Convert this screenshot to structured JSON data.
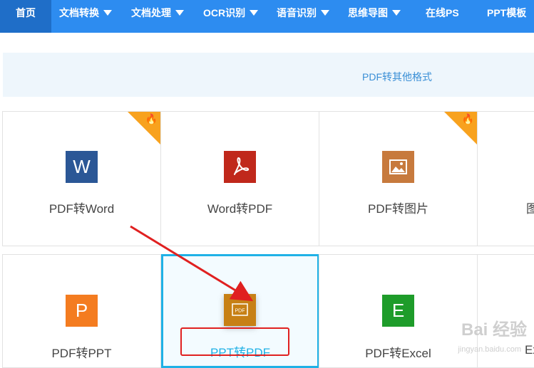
{
  "nav": {
    "items": [
      {
        "label": "首页",
        "active": true,
        "dropdown": false
      },
      {
        "label": "文档转换",
        "dropdown": true
      },
      {
        "label": "文档处理",
        "dropdown": true
      },
      {
        "label": "OCR识别",
        "dropdown": true
      },
      {
        "label": "语音识别",
        "dropdown": true
      },
      {
        "label": "思维导图",
        "dropdown": true
      },
      {
        "label": "在线PS",
        "dropdown": false
      },
      {
        "label": "PPT模板",
        "dropdown": false
      }
    ]
  },
  "category": {
    "label": "PDF转其他格式"
  },
  "tools": {
    "row1": [
      {
        "label": "PDF转Word",
        "icon": "word-icon",
        "icon_text": "W",
        "color": "#2b5796",
        "hot": true
      },
      {
        "label": "Word转PDF",
        "icon": "pdf-icon",
        "icon_text": "",
        "color": "#c0281b",
        "hot": false
      },
      {
        "label": "PDF转图片",
        "icon": "image-icon",
        "icon_text": "",
        "color": "#c77a3d",
        "hot": true
      },
      {
        "label": "图",
        "icon": "",
        "hot": false
      }
    ],
    "row2": [
      {
        "label": "PDF转PPT",
        "icon": "powerpoint-icon",
        "icon_text": "P",
        "color": "#f47c20"
      },
      {
        "label": "PPT转PDF",
        "icon": "ppt-to-pdf-icon",
        "icon_text": "PDF",
        "color": "#c78015",
        "selected": true
      },
      {
        "label": "PDF转Excel",
        "icon": "excel-icon",
        "icon_text": "E",
        "color": "#1e9c2a"
      },
      {
        "label": "Ex",
        "icon": ""
      }
    ]
  },
  "colors": {
    "nav_bg": "#2d8cf0",
    "nav_active": "#1f6ec8",
    "accent": "#1fb1e6",
    "annotation": "#e02020",
    "hot_badge": "#f8a21e"
  },
  "watermark": {
    "brand": "Bai 经验",
    "url": "jingyan.baidu.com"
  }
}
